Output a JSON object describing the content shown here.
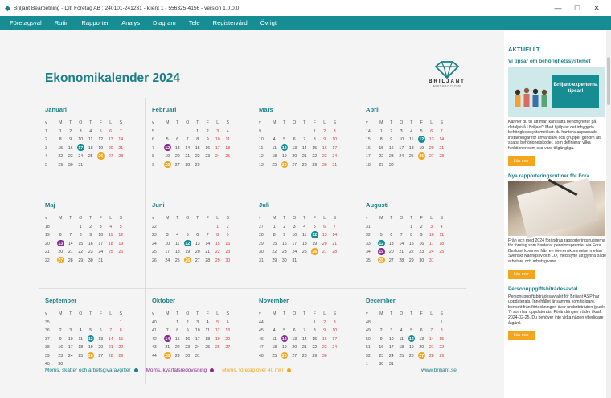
{
  "window": {
    "title": "Briljant Bearbetning - Ditt Företag AB : 240101-241231 - klient 1 - 556325-4156 - version 1.0.0.0",
    "minimize": "—",
    "maximize": "☐",
    "close": "✕"
  },
  "menu": [
    "Företagsval",
    "Rutin",
    "Rapporter",
    "Analys",
    "Diagram",
    "Tele",
    "Registervård",
    "Övrigt"
  ],
  "calendar": {
    "title": "Ekonomikalender 2024",
    "brand": {
      "name": "BRILJANT",
      "sub": "EKONOMISYSTEM"
    },
    "weekday_header": [
      "v",
      "M",
      "T",
      "O",
      "T",
      "F",
      "L",
      "S"
    ],
    "months": [
      {
        "name": "Januari",
        "weeks": [
          {
            "wk": "1",
            "days": [
              "1",
              "2",
              "3",
              "4",
              "5",
              "6",
              "7"
            ]
          },
          {
            "wk": "2",
            "days": [
              "8",
              "9",
              "10",
              "11",
              "12",
              "13",
              "14"
            ]
          },
          {
            "wk": "3",
            "days": [
              "15",
              "16",
              "17",
              "18",
              "19",
              "20",
              "21"
            ]
          },
          {
            "wk": "4",
            "days": [
              "22",
              "23",
              "24",
              "25",
              "26",
              "27",
              "28"
            ]
          },
          {
            "wk": "5",
            "days": [
              "29",
              "30",
              "31",
              "",
              "",
              "",
              ""
            ]
          }
        ]
      },
      {
        "name": "Februari",
        "weeks": [
          {
            "wk": "5",
            "days": [
              "",
              "",
              "",
              "1",
              "2",
              "3",
              "4"
            ]
          },
          {
            "wk": "6",
            "days": [
              "5",
              "6",
              "7",
              "8",
              "9",
              "10",
              "11"
            ]
          },
          {
            "wk": "7",
            "days": [
              "12",
              "13",
              "14",
              "15",
              "16",
              "17",
              "18"
            ]
          },
          {
            "wk": "8",
            "days": [
              "19",
              "20",
              "21",
              "22",
              "23",
              "24",
              "25"
            ]
          },
          {
            "wk": "9",
            "days": [
              "26",
              "27",
              "28",
              "29",
              "",
              "",
              ""
            ]
          }
        ]
      },
      {
        "name": "Mars",
        "weeks": [
          {
            "wk": "9",
            "days": [
              "",
              "",
              "",
              "",
              "1",
              "2",
              "3"
            ]
          },
          {
            "wk": "10",
            "days": [
              "4",
              "5",
              "6",
              "7",
              "8",
              "9",
              "10"
            ]
          },
          {
            "wk": "11",
            "days": [
              "11",
              "12",
              "13",
              "14",
              "15",
              "16",
              "17"
            ]
          },
          {
            "wk": "12",
            "days": [
              "18",
              "19",
              "20",
              "21",
              "22",
              "23",
              "24"
            ]
          },
          {
            "wk": "13",
            "days": [
              "25",
              "26",
              "27",
              "28",
              "29",
              "30",
              "31"
            ]
          }
        ]
      },
      {
        "name": "April",
        "weeks": [
          {
            "wk": "14",
            "days": [
              "1",
              "2",
              "3",
              "4",
              "5",
              "6",
              "7"
            ]
          },
          {
            "wk": "15",
            "days": [
              "8",
              "9",
              "10",
              "11",
              "12",
              "13",
              "14"
            ]
          },
          {
            "wk": "16",
            "days": [
              "15",
              "16",
              "17",
              "18",
              "19",
              "20",
              "21"
            ]
          },
          {
            "wk": "17",
            "days": [
              "22",
              "23",
              "24",
              "25",
              "26",
              "27",
              "28"
            ]
          },
          {
            "wk": "18",
            "days": [
              "29",
              "30",
              "",
              "",
              "",
              "",
              ""
            ]
          }
        ]
      },
      {
        "name": "Maj",
        "weeks": [
          {
            "wk": "18",
            "days": [
              "",
              "",
              "1",
              "2",
              "3",
              "4",
              "5"
            ]
          },
          {
            "wk": "19",
            "days": [
              "6",
              "7",
              "8",
              "9",
              "10",
              "11",
              "12"
            ]
          },
          {
            "wk": "20",
            "days": [
              "13",
              "14",
              "15",
              "16",
              "17",
              "18",
              "19"
            ]
          },
          {
            "wk": "21",
            "days": [
              "20",
              "21",
              "22",
              "23",
              "24",
              "25",
              "26"
            ]
          },
          {
            "wk": "22",
            "days": [
              "27",
              "28",
              "29",
              "30",
              "31",
              "",
              ""
            ]
          }
        ]
      },
      {
        "name": "Juni",
        "weeks": [
          {
            "wk": "22",
            "days": [
              "",
              "",
              "",
              "",
              "",
              "1",
              "2"
            ]
          },
          {
            "wk": "23",
            "days": [
              "3",
              "4",
              "5",
              "6",
              "7",
              "8",
              "9"
            ]
          },
          {
            "wk": "24",
            "days": [
              "10",
              "11",
              "12",
              "13",
              "14",
              "15",
              "16"
            ]
          },
          {
            "wk": "25",
            "days": [
              "17",
              "18",
              "19",
              "20",
              "21",
              "22",
              "23"
            ]
          },
          {
            "wk": "26",
            "days": [
              "24",
              "25",
              "26",
              "27",
              "28",
              "29",
              "30"
            ]
          }
        ]
      },
      {
        "name": "Juli",
        "weeks": [
          {
            "wk": "27",
            "days": [
              "1",
              "2",
              "3",
              "4",
              "5",
              "6",
              "7"
            ]
          },
          {
            "wk": "28",
            "days": [
              "8",
              "9",
              "10",
              "11",
              "12",
              "13",
              "14"
            ]
          },
          {
            "wk": "29",
            "days": [
              "15",
              "16",
              "17",
              "18",
              "19",
              "20",
              "21"
            ]
          },
          {
            "wk": "30",
            "days": [
              "22",
              "23",
              "24",
              "25",
              "26",
              "27",
              "28"
            ]
          },
          {
            "wk": "31",
            "days": [
              "29",
              "30",
              "31",
              "",
              "",
              "",
              ""
            ]
          }
        ]
      },
      {
        "name": "Augusti",
        "weeks": [
          {
            "wk": "31",
            "days": [
              "",
              "",
              "",
              "1",
              "2",
              "3",
              "4"
            ]
          },
          {
            "wk": "32",
            "days": [
              "5",
              "6",
              "7",
              "8",
              "9",
              "10",
              "11"
            ]
          },
          {
            "wk": "33",
            "days": [
              "12",
              "13",
              "14",
              "15",
              "16",
              "17",
              "18"
            ]
          },
          {
            "wk": "34",
            "days": [
              "19",
              "20",
              "21",
              "22",
              "23",
              "24",
              "25"
            ]
          },
          {
            "wk": "35",
            "days": [
              "26",
              "27",
              "28",
              "29",
              "30",
              "31",
              ""
            ]
          }
        ]
      },
      {
        "name": "September",
        "weeks": [
          {
            "wk": "35",
            "days": [
              "",
              "",
              "",
              "",
              "",
              "",
              "1"
            ]
          },
          {
            "wk": "36",
            "days": [
              "2",
              "3",
              "4",
              "5",
              "6",
              "7",
              "8"
            ]
          },
          {
            "wk": "37",
            "days": [
              "9",
              "10",
              "11",
              "12",
              "13",
              "14",
              "15"
            ]
          },
          {
            "wk": "38",
            "days": [
              "16",
              "17",
              "18",
              "19",
              "20",
              "21",
              "22"
            ]
          },
          {
            "wk": "39",
            "days": [
              "23",
              "24",
              "25",
              "26",
              "27",
              "28",
              "29"
            ]
          },
          {
            "wk": "40",
            "days": [
              "30",
              "",
              "",
              "",
              "",
              "",
              ""
            ]
          }
        ]
      },
      {
        "name": "Oktober",
        "weeks": [
          {
            "wk": "40",
            "days": [
              "",
              "1",
              "2",
              "3",
              "4",
              "5",
              "6"
            ]
          },
          {
            "wk": "41",
            "days": [
              "7",
              "8",
              "9",
              "10",
              "11",
              "12",
              "13"
            ]
          },
          {
            "wk": "42",
            "days": [
              "14",
              "15",
              "16",
              "17",
              "18",
              "19",
              "20"
            ]
          },
          {
            "wk": "43",
            "days": [
              "21",
              "22",
              "23",
              "24",
              "25",
              "26",
              "27"
            ]
          },
          {
            "wk": "44",
            "days": [
              "28",
              "29",
              "30",
              "31",
              "",
              "",
              ""
            ]
          }
        ]
      },
      {
        "name": "November",
        "weeks": [
          {
            "wk": "44",
            "days": [
              "",
              "",
              "",
              "",
              "1",
              "2",
              "3"
            ]
          },
          {
            "wk": "45",
            "days": [
              "4",
              "5",
              "6",
              "7",
              "8",
              "9",
              "10"
            ]
          },
          {
            "wk": "46",
            "days": [
              "11",
              "12",
              "13",
              "14",
              "15",
              "16",
              "17"
            ]
          },
          {
            "wk": "47",
            "days": [
              "18",
              "19",
              "20",
              "21",
              "22",
              "23",
              "24"
            ]
          },
          {
            "wk": "48",
            "days": [
              "25",
              "26",
              "27",
              "28",
              "29",
              "30",
              ""
            ]
          }
        ]
      },
      {
        "name": "December",
        "weeks": [
          {
            "wk": "48",
            "days": [
              "",
              "",
              "",
              "",
              "",
              "",
              "1"
            ]
          },
          {
            "wk": "49",
            "days": [
              "2",
              "3",
              "4",
              "5",
              "6",
              "7",
              "8"
            ]
          },
          {
            "wk": "50",
            "days": [
              "9",
              "10",
              "11",
              "12",
              "13",
              "14",
              "15"
            ]
          },
          {
            "wk": "51",
            "days": [
              "16",
              "17",
              "18",
              "19",
              "20",
              "21",
              "22"
            ]
          },
          {
            "wk": "52",
            "days": [
              "23",
              "24",
              "25",
              "26",
              "27",
              "28",
              "29"
            ]
          },
          {
            "wk": "1",
            "days": [
              "30",
              "31",
              "",
              "",
              "",
              "",
              ""
            ]
          }
        ]
      }
    ],
    "marks": {
      "teal": [
        [
          0,
          "17"
        ],
        [
          1,
          "12"
        ],
        [
          2,
          "12"
        ],
        [
          3,
          "12"
        ],
        [
          4,
          "13"
        ],
        [
          5,
          "12"
        ],
        [
          6,
          "12"
        ],
        [
          7,
          "12"
        ],
        [
          8,
          "12"
        ],
        [
          9,
          "14"
        ],
        [
          10,
          "12"
        ],
        [
          11,
          "12"
        ]
      ],
      "purple": [
        [
          1,
          "12"
        ],
        [
          4,
          "13"
        ],
        [
          7,
          "19"
        ],
        [
          9,
          "14"
        ],
        [
          10,
          "12"
        ]
      ],
      "orange": [
        [
          0,
          "26"
        ],
        [
          1,
          "26"
        ],
        [
          2,
          "26"
        ],
        [
          3,
          "26"
        ],
        [
          4,
          "27"
        ],
        [
          5,
          "26"
        ],
        [
          6,
          "26"
        ],
        [
          7,
          "26"
        ],
        [
          8,
          "26"
        ],
        [
          9,
          "28"
        ],
        [
          10,
          "26"
        ],
        [
          11,
          "27"
        ]
      ]
    },
    "legend": [
      {
        "label": "Moms, skatter och arbetsgivaravgifter",
        "color": "#1a7f86"
      },
      {
        "label": "Moms, kvartalsredovisning",
        "color": "#8a2b8e"
      },
      {
        "label": "Moms, företag över 40 mkr",
        "color": "#f5a51c"
      }
    ],
    "url": "www.briljant.se"
  },
  "sidebar": {
    "heading": "AKTUELLT",
    "articles": [
      {
        "title": "Vi tipsar om behörighetssystemet",
        "image_text": "Briljant-experterna tipsar!",
        "text": "Känner du till att man kan sätta behörigheter på detaljnivå i Briljant? Med hjälp av det inbyggda behörighetssystemet kan du hantera anpassade inställningar för användare och grupper genom att skapa behörighetskoder, som definierar vilka funktioner som ska vara tillgängliga.",
        "button": "Läs mer"
      },
      {
        "title": "Nya rapporteringsrutiner för Fora",
        "text": "Från och med 2024 förändras rapporteringsrutinerna för företag som hanterar pensionspremier via Fora. Beslutet kommer från en överenskommelse mellan Svenskt Näringsliv och LO, med syfte att gynna både arbetare och arbetsgivare.",
        "button": "Läs mer"
      },
      {
        "title": "Personuppgiftsbiträdesavtal",
        "text": "Personuppgiftsbiträdesavtalet för Briljant ASP har uppdaterats. Innehållet är samma som tidigare, bortsett från förteckningen över underbiträden (punkt 7) som har uppdaterats. Förändringen träder i kraft 2024-02-25. Du behöver inte vidta någon ytterligare åtgärd.",
        "button": "Läs mer"
      }
    ]
  },
  "colors": {
    "accent": "#1a7f86",
    "menubar": "#168d93",
    "weekend": "#d6333a",
    "purple": "#8a2b8e",
    "orange": "#f5a51c"
  }
}
